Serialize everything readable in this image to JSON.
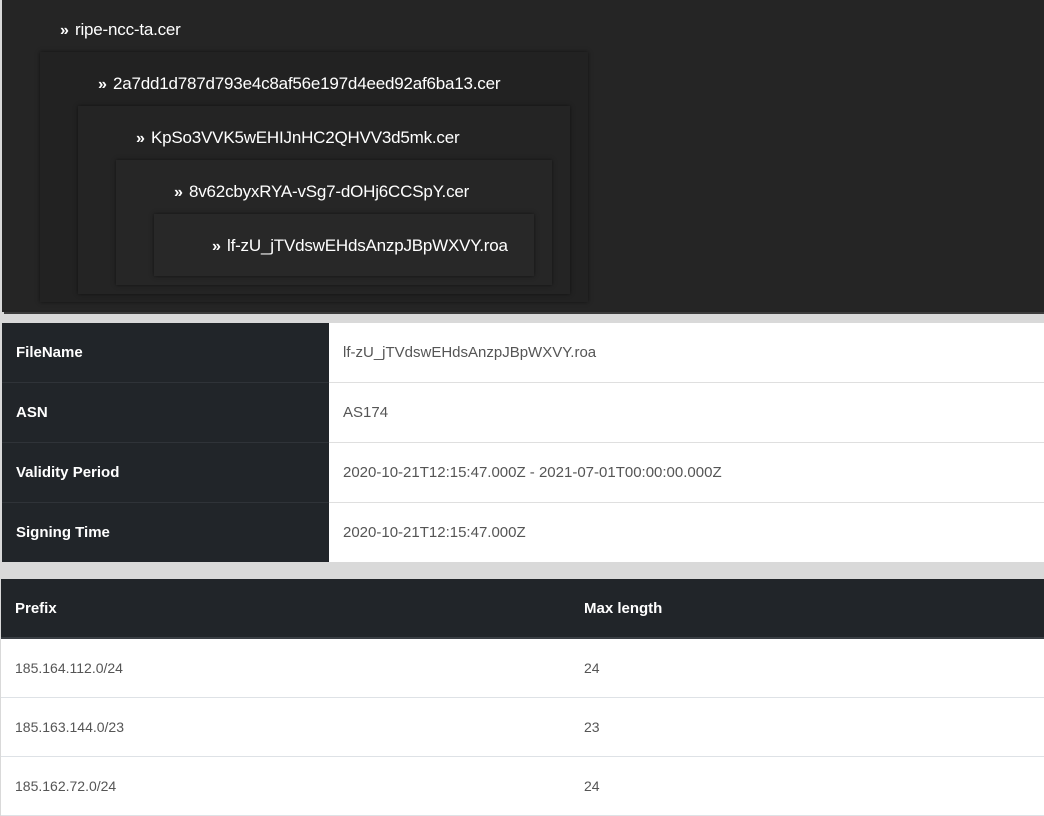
{
  "chain": [
    {
      "name": "ripe-ncc-ta.cer",
      "icon": "double-chevron-right-icon"
    },
    {
      "name": "2a7dd1d787d793e4c8af56e197d4eed92af6ba13.cer",
      "icon": "double-chevron-right-icon"
    },
    {
      "name": "KpSo3VVK5wEHIJnHC2QHVV3d5mk.cer",
      "icon": "double-chevron-right-icon"
    },
    {
      "name": "8v62cbyxRYA-vSg7-dOHj6CCSpY.cer",
      "icon": "double-chevron-right-icon"
    },
    {
      "name": "lf-zU_jTVdswEHdsAnzpJBpWXVY.roa",
      "icon": "double-chevron-right-icon"
    }
  ],
  "details": [
    {
      "label": "FileName",
      "value": "lf-zU_jTVdswEHdsAnzpJBpWXVY.roa"
    },
    {
      "label": "ASN",
      "value": "AS174"
    },
    {
      "label": "Validity Period",
      "value": "2020-10-21T12:15:47.000Z - 2021-07-01T00:00:00.000Z"
    },
    {
      "label": "Signing Time",
      "value": "2020-10-21T12:15:47.000Z"
    }
  ],
  "prefix_table": {
    "headers": [
      "Prefix",
      "Max length"
    ],
    "rows": [
      [
        "185.164.112.0/24",
        "24"
      ],
      [
        "185.163.144.0/23",
        "23"
      ],
      [
        "185.162.72.0/24",
        "24"
      ]
    ]
  },
  "colors": {
    "tree_background": "#252525",
    "header_background": "#212529",
    "page_background": "#d9d9d9"
  }
}
